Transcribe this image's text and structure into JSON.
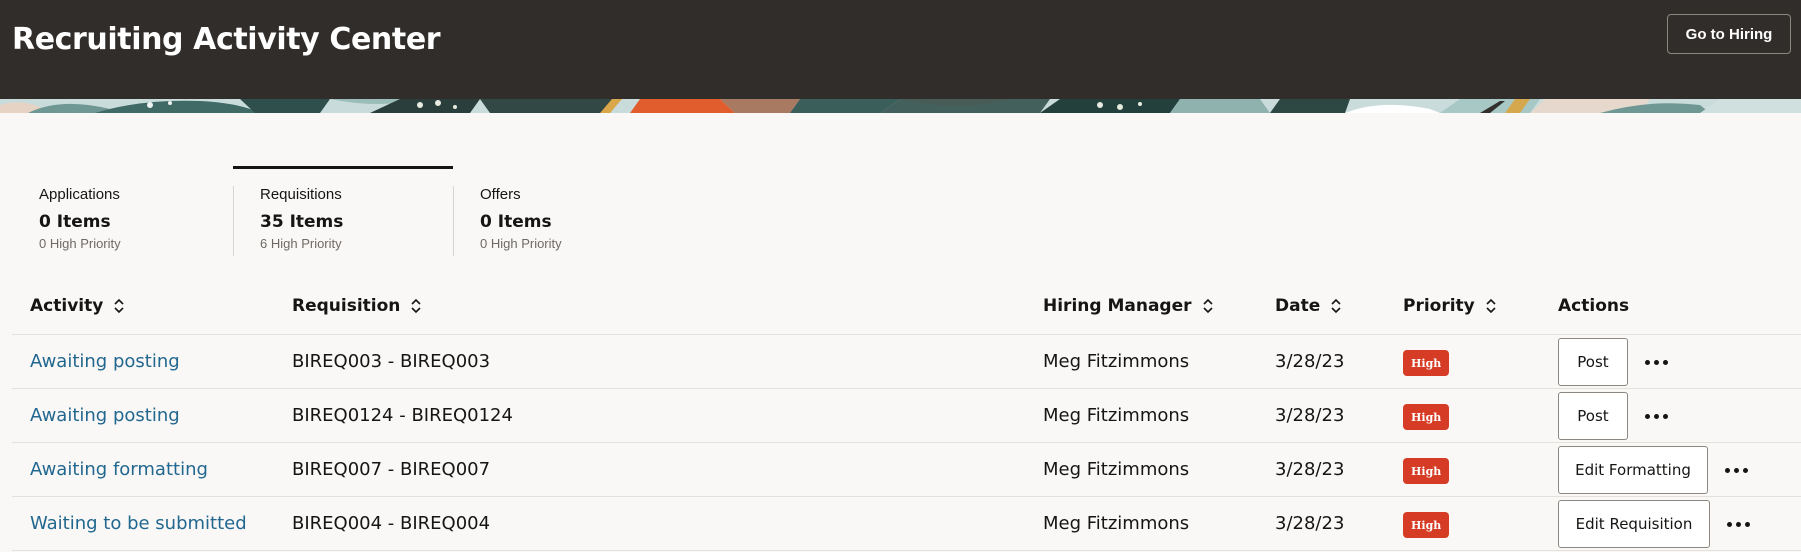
{
  "header": {
    "title": "Recruiting Activity Center",
    "go_to_hiring_label": "Go to Hiring",
    "background_color": "#312d2a"
  },
  "tabs": [
    {
      "name": "Applications",
      "count": "0 Items",
      "priority": "0 High Priority",
      "active": false
    },
    {
      "name": "Requisitions",
      "count": "35 Items",
      "priority": "6 High Priority",
      "active": true
    },
    {
      "name": "Offers",
      "count": "0 Items",
      "priority": "0 High Priority",
      "active": false
    }
  ],
  "table": {
    "columns": [
      "Activity",
      "Requisition",
      "Hiring Manager",
      "Date",
      "Priority",
      "Actions"
    ],
    "rows": [
      {
        "activity": "Awaiting posting",
        "requisition": "BIREQ003 - BIREQ003",
        "hiring_manager": "Meg Fitzimmons",
        "date": "3/28/23",
        "priority": "High",
        "action": "Post"
      },
      {
        "activity": "Awaiting posting",
        "requisition": "BIREQ0124 - BIREQ0124",
        "hiring_manager": "Meg Fitzimmons",
        "date": "3/28/23",
        "priority": "High",
        "action": "Post"
      },
      {
        "activity": "Awaiting formatting",
        "requisition": "BIREQ007 - BIREQ007",
        "hiring_manager": "Meg Fitzimmons",
        "date": "3/28/23",
        "priority": "High",
        "action": "Edit Formatting"
      },
      {
        "activity": "Waiting to be submitted",
        "requisition": "BIREQ004 - BIREQ004",
        "hiring_manager": "Meg Fitzimmons",
        "date": "3/28/23",
        "priority": "High",
        "action": "Edit Requisition"
      }
    ]
  },
  "colors": {
    "link": "#22678f",
    "priority_badge": "#d63b25",
    "page_background": "#f9f8f6"
  },
  "icons": {
    "sort": "sort-arrows-icon",
    "more": "more-actions-icon"
  }
}
